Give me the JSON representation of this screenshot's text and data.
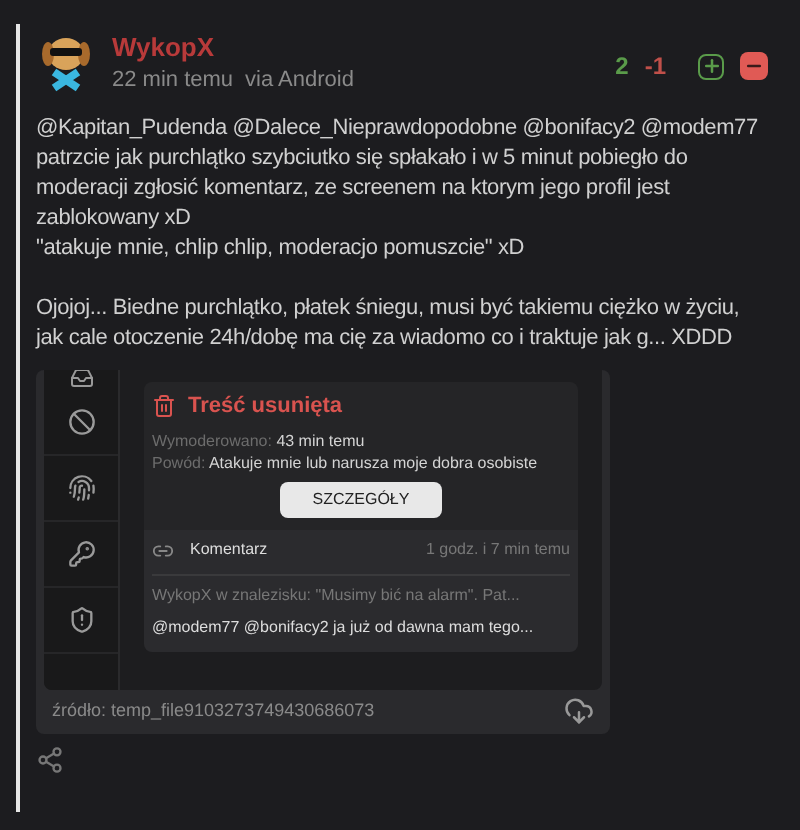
{
  "post": {
    "author": "WykopX",
    "time": "22 min temu",
    "via": "via Android",
    "votes_up": "2",
    "votes_down": "-1"
  },
  "body": [
    {
      "lines": [
        "@Kapitan_Pudenda @Dalece_Nieprawdopodobne @bonifacy2 @modem77 patrzcie jak purchlątko szybciutko się spłakało i w 5 minut pobiegło do moderacji zgłosić komentarz, ze screenem na ktorym jego profil jest zablokowany xD",
        "\"atakuje mnie, chlip chlip, moderacjo pomuszcie\" xD"
      ]
    },
    {
      "lines": [
        "Ojojoj... Biedne purchlątko, płatek śniegu, musi być takiemu ciężko w życiu, jak cale otoczenie 24h/dobę ma cię za wiadomo co i traktuje jak g... XDDD"
      ]
    }
  ],
  "embed": {
    "removed": {
      "title": "Treść usunięta",
      "moderated_label": "Wymoderowano:",
      "moderated_value": "43 min temu",
      "reason_label": "Powód:",
      "reason_value": "Atakuje mnie lub narusza moje dobra osobiste",
      "button": "SZCZEGÓŁY"
    },
    "comment": {
      "label": "Komentarz",
      "time": "1 godz. i 7 min temu",
      "context": "WykopX w znalezisku: \"Musimy bić na alarm\". Pat...",
      "text": "@modem77 @bonifacy2 ja już od dawna mam tego..."
    },
    "source": "źródło: temp_file9103273749430686073"
  }
}
